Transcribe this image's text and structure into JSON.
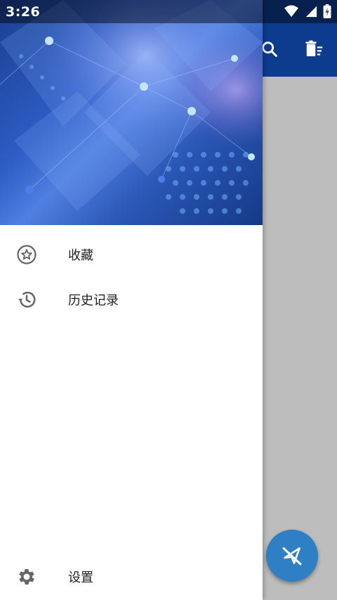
{
  "status_bar": {
    "time": "3:26",
    "icons": [
      "wifi-icon",
      "cellular-signal-icon",
      "battery-charging-icon"
    ]
  },
  "toolbar": {
    "icons": [
      "search-icon",
      "delete-sweep-icon"
    ],
    "background_color": "#0d3c8e"
  },
  "drawer": {
    "header_image": "abstract-blue-network-background",
    "items": [
      {
        "label": "收藏",
        "icon": "star-circle-icon"
      },
      {
        "label": "历史记录",
        "icon": "history-icon"
      }
    ],
    "footer_item": {
      "label": "设置",
      "icon": "gear-icon"
    }
  },
  "fab": {
    "icon": "paper-plane-crossed-icon",
    "color": "#2f7fc4"
  }
}
